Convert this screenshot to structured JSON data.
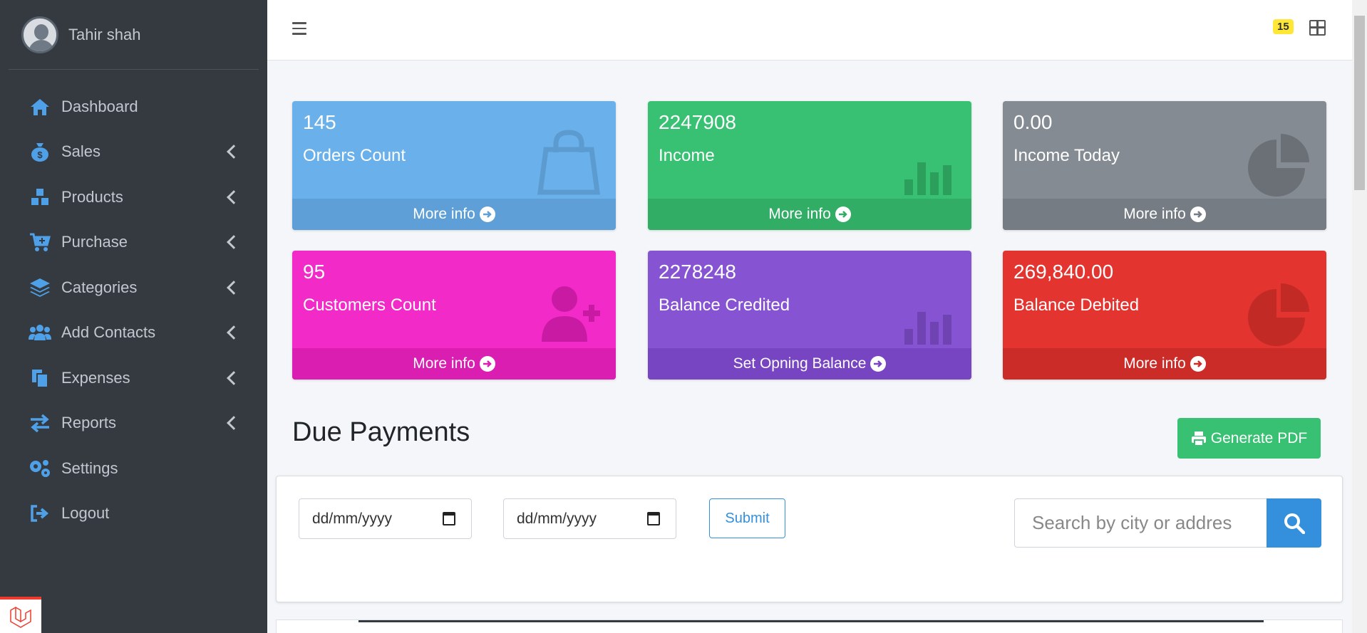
{
  "user": {
    "name": "Tahir shah"
  },
  "sidebar": {
    "items": [
      {
        "label": "Dashboard",
        "icon": "home-icon",
        "expandable": false
      },
      {
        "label": "Sales",
        "icon": "money-bag-icon",
        "expandable": true
      },
      {
        "label": "Products",
        "icon": "boxes-icon",
        "expandable": true
      },
      {
        "label": "Purchase",
        "icon": "cart-plus-icon",
        "expandable": true
      },
      {
        "label": "Categories",
        "icon": "layers-icon",
        "expandable": true
      },
      {
        "label": "Add Contacts",
        "icon": "users-icon",
        "expandable": true
      },
      {
        "label": "Expenses",
        "icon": "copy-icon",
        "expandable": true
      },
      {
        "label": "Reports",
        "icon": "exchange-icon",
        "expandable": true
      },
      {
        "label": "Settings",
        "icon": "cogs-icon",
        "expandable": false
      },
      {
        "label": "Logout",
        "icon": "sign-out-icon",
        "expandable": false
      }
    ]
  },
  "header": {
    "notification_count": "15"
  },
  "cards": [
    {
      "value": "145",
      "label": "Orders Count",
      "footer": "More info",
      "color": "#6ab0ea",
      "icon": "shopping-bag-icon"
    },
    {
      "value": "2247908",
      "label": "Income",
      "footer": "More info",
      "color": "#38c172",
      "icon": "bar-chart-icon"
    },
    {
      "value": "0.00",
      "label": "Income Today",
      "footer": "More info",
      "color": "#858b92",
      "icon": "pie-chart-icon"
    },
    {
      "value": "95",
      "label": "Customers Count",
      "footer": "More info",
      "color": "#f22ac8",
      "icon": "user-plus-icon"
    },
    {
      "value": "2278248",
      "label": "Balance Credited",
      "footer": "Set Opning Balance",
      "color": "#8654d3",
      "icon": "bar-chart-icon"
    },
    {
      "value": "269,840.00",
      "label": "Balance Debited",
      "footer": "More info",
      "color": "#e3342f",
      "icon": "pie-chart-icon"
    }
  ],
  "due_payments": {
    "title": "Due Payments",
    "generate_pdf_label": "Generate PDF",
    "date_from": "dd/mm/yyyy",
    "date_to": "dd/mm/yyyy",
    "submit_label": "Submit",
    "search_placeholder": "Search by city or addres"
  }
}
